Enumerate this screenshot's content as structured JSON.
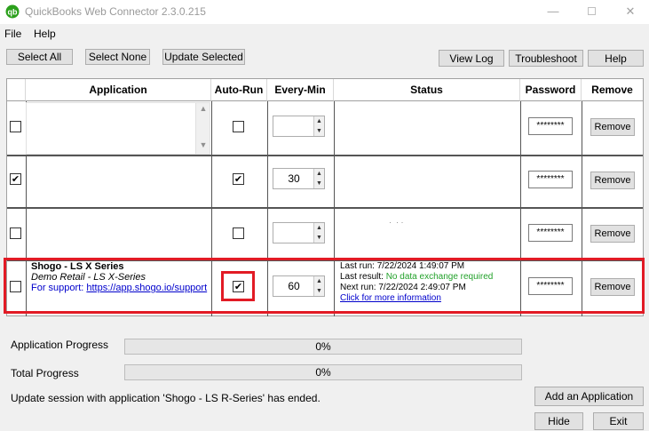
{
  "window": {
    "title": "QuickBooks Web Connector 2.3.0.215",
    "minimize": "—",
    "close": "✕"
  },
  "menu": {
    "file": "File",
    "help": "Help"
  },
  "toolbar": {
    "select_all": "Select All",
    "select_none": "Select None",
    "update_selected": "Update Selected",
    "view_log": "View Log",
    "troubleshoot": "Troubleshoot",
    "help": "Help"
  },
  "grid": {
    "headers": {
      "application": "Application",
      "auto_run": "Auto-Run",
      "every_min": "Every-Min",
      "status": "Status",
      "password": "Password",
      "remove": "Remove"
    },
    "rows": [
      {
        "selected": false,
        "auto_run": false,
        "every_min": "",
        "password": "********",
        "remove": "Remove"
      },
      {
        "selected": true,
        "auto_run": true,
        "every_min": "30",
        "password": "********",
        "remove": "Remove"
      },
      {
        "selected": false,
        "auto_run": false,
        "every_min": "",
        "password": "********",
        "remove": "Remove"
      },
      {
        "selected": false,
        "auto_run": true,
        "every_min": "60",
        "password": "********",
        "remove": "Remove",
        "app_name": "Shogo - LS X Series",
        "app_desc": "Demo Retail - LS X-Series",
        "support_label": "For support:",
        "support_url": "https://app.shogo.io/support",
        "status": {
          "last_run_label": "Last run:",
          "last_run": "7/22/2024 1:49:07 PM",
          "last_result_label": "Last result:",
          "last_result": "No data exchange required",
          "next_run_label": "Next run:",
          "next_run": "7/22/2024 2:49:07 PM",
          "more_info": "Click for more information"
        }
      }
    ]
  },
  "progress": {
    "application_label": "Application Progress",
    "application_value": "0%",
    "total_label": "Total Progress",
    "total_value": "0%"
  },
  "footer": {
    "message": "Update session with application 'Shogo - LS R-Series' has ended.",
    "add_application": "Add an Application",
    "hide": "Hide",
    "exit": "Exit"
  },
  "colors": {
    "highlight": "#e21b25",
    "success_text": "#22a12a",
    "link": "#0000cc"
  }
}
